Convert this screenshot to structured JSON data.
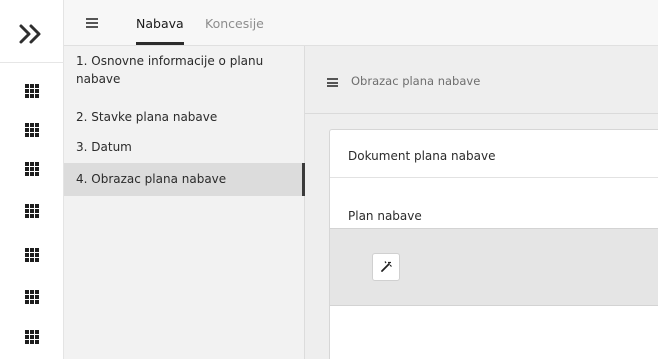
{
  "rail": {
    "logo_icon": "double-chevron-logo",
    "items": [
      {
        "icon": "grid-icon"
      },
      {
        "icon": "grid-icon"
      },
      {
        "icon": "grid-icon"
      },
      {
        "icon": "grid-icon"
      },
      {
        "icon": "grid-icon"
      },
      {
        "icon": "grid-icon"
      },
      {
        "icon": "grid-icon"
      }
    ]
  },
  "topbar": {
    "menu_icon": "hamburger-icon",
    "tabs": [
      {
        "label": "Nabava",
        "active": true
      },
      {
        "label": "Koncesije",
        "active": false
      }
    ]
  },
  "steps": [
    {
      "label": "1. Osnovne informacije o planu",
      "label2": "nabave"
    },
    {
      "label": "2. Stavke plana nabave"
    },
    {
      "label": "3. Datum"
    },
    {
      "label": "4. Obrazac plana nabave",
      "active": true
    }
  ],
  "main": {
    "menu_icon": "hamburger-icon",
    "title": "Obrazac plana nabave",
    "card": {
      "title": "Dokument plana nabave",
      "field_label": "Plan nabave",
      "button_icon": "magic-wand-icon"
    }
  },
  "colors": {
    "accent": "#2b2b2b",
    "active_step_bg": "#dcdcdc",
    "sidebar_bg": "#f2f2f2",
    "main_bg": "#eeeeee"
  }
}
